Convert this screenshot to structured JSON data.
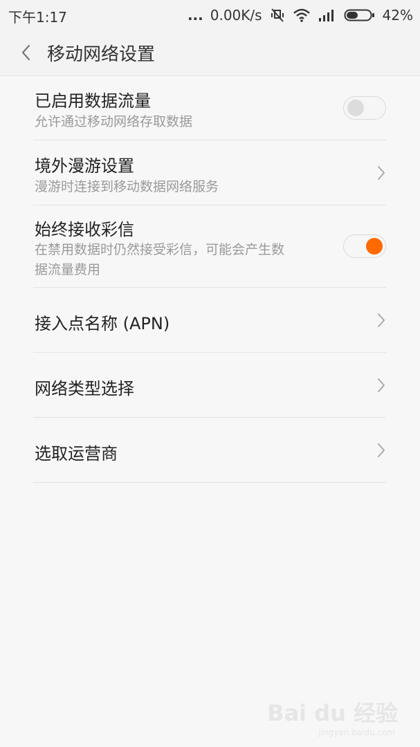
{
  "status_bar": {
    "time": "下午1:17",
    "dots": "...",
    "network_speed": "0.00K/s",
    "battery": "42%",
    "icons": [
      "mute-vibrate-icon",
      "wifi-icon",
      "signal-icon",
      "battery-icon"
    ]
  },
  "header": {
    "back_icon": "chevron-left-icon",
    "title": "移动网络设置"
  },
  "settings": {
    "items": [
      {
        "title": "已启用数据流量",
        "subtitle": "允许通过移动网络存取数据",
        "control": "toggle",
        "on": false
      },
      {
        "title": "境外漫游设置",
        "subtitle": "漫游时连接到移动数据网络服务",
        "control": "chevron"
      },
      {
        "title": "始终接收彩信",
        "subtitle_line1": "在禁用数据时仍然接受彩信，可能会产生数",
        "subtitle_line2": "据流量费用",
        "control": "toggle",
        "on": true
      },
      {
        "title": "接入点名称 (APN)",
        "control": "chevron"
      },
      {
        "title": "网络类型选择",
        "control": "chevron"
      },
      {
        "title": "选取运营商",
        "control": "chevron"
      }
    ]
  },
  "colors": {
    "accent": "#ff6a00",
    "background": "#f7f7f7",
    "divider": "#e3e3e3"
  },
  "watermark": {
    "text": "Bai du 经验",
    "url_text": "jingyan.baidu.com"
  }
}
